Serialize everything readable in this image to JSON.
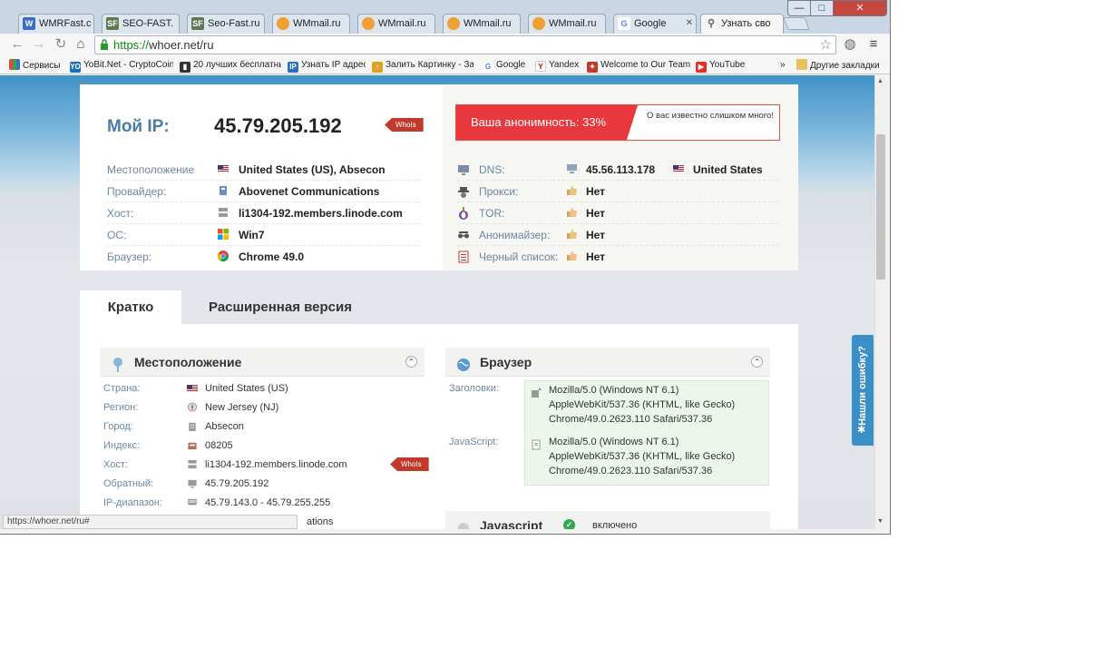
{
  "browser": {
    "tabs": [
      {
        "label": "WMRFast.c",
        "favicon_color": "#3a6fc4",
        "favicon_glyph": "W"
      },
      {
        "label": "SEO-FAST.",
        "favicon_color": "#5c7a52",
        "favicon_glyph": "SF"
      },
      {
        "label": "Seo-Fast.ru",
        "favicon_color": "#5c7a52",
        "favicon_glyph": "SF"
      },
      {
        "label": "WMmail.ru",
        "favicon_color": "#f0a030",
        "favicon_glyph": ""
      },
      {
        "label": "WMmail.ru",
        "favicon_color": "#f0a030",
        "favicon_glyph": ""
      },
      {
        "label": "WMmail.ru",
        "favicon_color": "#f0a030",
        "favicon_glyph": ""
      },
      {
        "label": "WMmail.ru",
        "favicon_color": "#f0a030",
        "favicon_glyph": ""
      },
      {
        "label": "Google",
        "favicon_color": "#ffffff",
        "favicon_glyph": "G"
      },
      {
        "label": "Узнать сво",
        "favicon_color": "#ffffff",
        "favicon_glyph": "search-icon"
      }
    ],
    "window_controls": {
      "minimize": "—",
      "maximize": "□",
      "close": "✕"
    },
    "url_scheme": "https://",
    "url_rest": "whoer.net/ru",
    "bookmarks": [
      {
        "label": "Сервисы",
        "icon": "apps-icon",
        "color": "#e04a3a"
      },
      {
        "label": "YoBit.Net - CryptoCoin",
        "icon": "YO",
        "color": "#1a6fb5"
      },
      {
        "label": "20 лучших бесплатных",
        "icon": "film-icon",
        "color": "#333333"
      },
      {
        "label": "Узнать IP адрес",
        "icon": "IP",
        "color": "#2a6fc0"
      },
      {
        "label": "Залить Картинку - За",
        "icon": "upload-icon",
        "color": "#e0a020"
      },
      {
        "label": "Google",
        "icon": "G",
        "color": "#4285f4"
      },
      {
        "label": "Yandex",
        "icon": "Y",
        "color": "#cc0000"
      },
      {
        "label": "Welcome to Our Team",
        "icon": "team-icon",
        "color": "#c0392b"
      },
      {
        "label": "YouTube",
        "icon": "youtube-icon",
        "color": "#e52d27"
      }
    ],
    "bookmarks_overflow": "»",
    "other_bookmarks": "Другие закладки",
    "status_url": "https://whoer.net/ru#"
  },
  "page": {
    "myip_label": "Мой IP:",
    "myip_value": "45.79.205.192",
    "whois_label": "WhoIs",
    "left_rows": [
      {
        "label": "Местоположение",
        "icon": "flag-us",
        "value": "United States (US), Absecon"
      },
      {
        "label": "Провайдер:",
        "icon": "provider-icon",
        "value": "Abovenet Communications"
      },
      {
        "label": "Хост:",
        "icon": "server-icon",
        "value": "li1304-192.members.linode.com"
      },
      {
        "label": "ОС:",
        "icon": "windows-icon",
        "value": "Win7"
      },
      {
        "label": "Браузер:",
        "icon": "chrome-icon",
        "value": "Chrome 49.0"
      }
    ],
    "anonymity_label": "Ваша анонимность: 33%",
    "anonymity_percent": 33,
    "anonymity_note": "О вас известно слишком много!",
    "right_rows": [
      {
        "label": "DNS:",
        "icon": "dns-icon",
        "value": "45.56.113.178",
        "extra": "United States"
      },
      {
        "label": "Прокси:",
        "icon": "spy-icon",
        "value": "Нет"
      },
      {
        "label": "TOR:",
        "icon": "tor-icon",
        "value": "Нет"
      },
      {
        "label": "Анонимайзер:",
        "icon": "glasses-icon",
        "value": "Нет"
      },
      {
        "label": "Черный список:",
        "icon": "list-icon",
        "value": "Нет"
      }
    ],
    "tabs": {
      "brief": "Кратко",
      "extended": "Расширенная версия"
    },
    "location_section": {
      "title": "Местоположение",
      "rows": [
        {
          "label": "Страна:",
          "value": "United States (US)"
        },
        {
          "label": "Регион:",
          "value": "New Jersey (NJ)"
        },
        {
          "label": "Город:",
          "value": "Absecon"
        },
        {
          "label": "Индекс:",
          "value": "08205"
        },
        {
          "label": "Хост:",
          "value": "li1304-192.members.linode.com"
        },
        {
          "label": "Обратный:",
          "value": "45.79.205.192"
        },
        {
          "label": "IP-диапазон:",
          "value": "45.79.143.0 - 45.79.255.255"
        }
      ],
      "partial_last": "ations"
    },
    "browser_section": {
      "title": "Браузер",
      "headers_label": "Заголовки:",
      "headers_ua": [
        "Mozilla/5.0 (Windows NT 6.1)",
        "AppleWebKit/537.36 (KHTML, like Gecko)",
        "Chrome/49.0.2623.110 Safari/537.36"
      ],
      "js_label": "JavaScript:",
      "js_ua": [
        "Mozilla/5.0 (Windows NT 6.1)",
        "AppleWebKit/537.36 (KHTML, like Gecko)",
        "Chrome/49.0.2623.110 Safari/537.36"
      ]
    },
    "javascript_section": {
      "title": "Javascript",
      "status": "включено"
    },
    "report_button": "Нашли ошибку?"
  },
  "colors": {
    "accent": "#4a7da8",
    "danger": "#e8383d",
    "brand_blue": "#3a8fc9"
  }
}
